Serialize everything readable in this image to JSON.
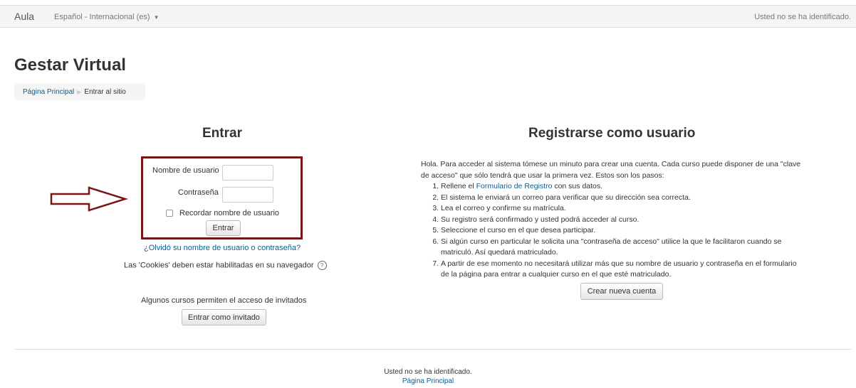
{
  "navbar": {
    "brand": "Aula",
    "language": "Español - Internacional (es)",
    "login_status": "Usted no se ha identificado."
  },
  "page_title": "Gestar Virtual",
  "breadcrumb": {
    "home": "Página Principal",
    "current": "Entrar al sitio"
  },
  "login": {
    "title": "Entrar",
    "username_label": "Nombre de usuario",
    "password_label": "Contraseña",
    "remember_label": "Recordar nombre de usuario",
    "submit_label": "Entrar",
    "forgot_link": "¿Olvidó su nombre de usuario o contraseña?",
    "cookies_notice": "Las 'Cookies' deben estar habilitadas en su navegador",
    "guest_notice": "Algunos cursos permiten el acceso de invitados",
    "guest_button": "Entrar como invitado"
  },
  "signup": {
    "title": "Registrarse como usuario",
    "intro": "Hola. Para acceder al sistema tómese un minuto para crear una cuenta. Cada curso puede disponer de una \"clave de acceso\" que sólo tendrá que usar la primera vez. Estos son los pasos:",
    "step1_prefix": "Rellene el ",
    "step1_link": "Formulario de Registro",
    "step1_suffix": " con sus datos.",
    "step2": "El sistema le enviará un correo para verificar que su dirección sea correcta.",
    "step3": "Lea el correo y confirme su matrícula.",
    "step4": "Su registro será confirmado y usted podrá acceder al curso.",
    "step5": "Seleccione el curso en el que desea participar.",
    "step6": "Si algún curso en particular le solicita una \"contraseña de acceso\" utilice la que le facilitaron cuando se matriculó. Así quedará matriculado.",
    "step7": "A partir de ese momento no necesitará utilizar más que su nombre de usuario y contraseña en el formulario de la página para entrar a cualquier curso en el que esté matriculado.",
    "create_button": "Crear nueva cuenta"
  },
  "footer": {
    "status": "Usted no se ha identificado.",
    "home_link": "Página Principal"
  },
  "colors": {
    "highlight_border": "#7b1416",
    "link": "#0e5c8c"
  },
  "icons": {
    "annotation": "arrow-right-icon",
    "help": "help-icon",
    "dropdown": "caret-down-icon"
  }
}
